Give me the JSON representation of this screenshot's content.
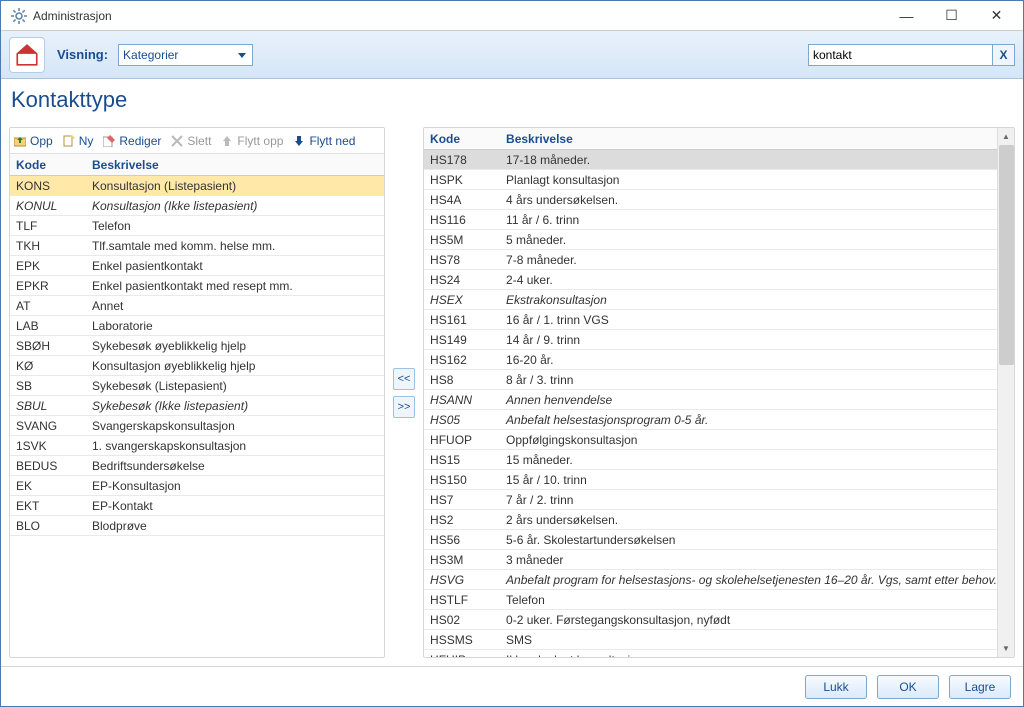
{
  "window": {
    "title": "Administrasjon"
  },
  "topbar": {
    "visning_label": "Visning:",
    "dropdown_value": "Kategorier",
    "search_value": "kontakt"
  },
  "page_title": "Kontakttype",
  "toolbar": {
    "opp": "Opp",
    "ny": "Ny",
    "rediger": "Rediger",
    "slett": "Slett",
    "flytt_opp": "Flytt opp",
    "flytt_ned": "Flytt ned"
  },
  "columns": {
    "kode": "Kode",
    "beskrivelse": "Beskrivelse"
  },
  "left_rows": [
    {
      "kode": "KONS",
      "beskrivelse": "Konsultasjon (Listepasient)",
      "selected": true
    },
    {
      "kode": "KONUL",
      "beskrivelse": "Konsultasjon (Ikke listepasient)",
      "italic": true
    },
    {
      "kode": "TLF",
      "beskrivelse": "Telefon"
    },
    {
      "kode": "TKH",
      "beskrivelse": "Tlf.samtale med komm. helse mm."
    },
    {
      "kode": "EPK",
      "beskrivelse": "Enkel pasientkontakt"
    },
    {
      "kode": "EPKR",
      "beskrivelse": "Enkel pasientkontakt med resept mm."
    },
    {
      "kode": "AT",
      "beskrivelse": "Annet"
    },
    {
      "kode": "LAB",
      "beskrivelse": "Laboratorie"
    },
    {
      "kode": "SBØH",
      "beskrivelse": "Sykebesøk øyeblikkelig hjelp"
    },
    {
      "kode": "KØ",
      "beskrivelse": "Konsultasjon øyeblikkelig hjelp"
    },
    {
      "kode": "SB",
      "beskrivelse": "Sykebesøk (Listepasient)"
    },
    {
      "kode": "SBUL",
      "beskrivelse": "Sykebesøk (Ikke listepasient)",
      "italic": true
    },
    {
      "kode": "SVANG",
      "beskrivelse": "Svangerskapskonsultasjon"
    },
    {
      "kode": "1SVK",
      "beskrivelse": "1. svangerskapskonsultasjon"
    },
    {
      "kode": "BEDUS",
      "beskrivelse": "Bedriftsundersøkelse"
    },
    {
      "kode": "EK",
      "beskrivelse": "EP-Konsultasjon"
    },
    {
      "kode": "EKT",
      "beskrivelse": "EP-Kontakt"
    },
    {
      "kode": "BLO",
      "beskrivelse": "Blodprøve"
    }
  ],
  "right_rows": [
    {
      "kode": "HS178",
      "beskrivelse": "17-18 måneder.",
      "selected": true
    },
    {
      "kode": "HSPK",
      "beskrivelse": "Planlagt konsultasjon"
    },
    {
      "kode": "HS4A",
      "beskrivelse": "4 års undersøkelsen."
    },
    {
      "kode": "HS116",
      "beskrivelse": "11 år / 6. trinn"
    },
    {
      "kode": "HS5M",
      "beskrivelse": "5 måneder."
    },
    {
      "kode": "HS78",
      "beskrivelse": "7-8 måneder."
    },
    {
      "kode": "HS24",
      "beskrivelse": "2-4 uker."
    },
    {
      "kode": "HSEX",
      "beskrivelse": "Ekstrakonsultasjon",
      "italic": true
    },
    {
      "kode": "HS161",
      "beskrivelse": "16 år / 1. trinn VGS"
    },
    {
      "kode": "HS149",
      "beskrivelse": "14 år / 9. trinn"
    },
    {
      "kode": "HS162",
      "beskrivelse": "16-20 år."
    },
    {
      "kode": "HS8",
      "beskrivelse": "8 år / 3. trinn"
    },
    {
      "kode": "HSANN",
      "beskrivelse": "Annen henvendelse",
      "italic": true
    },
    {
      "kode": "HS05",
      "beskrivelse": "Anbefalt helsestasjonsprogram 0-5 år.",
      "italic": true
    },
    {
      "kode": "HFUOP",
      "beskrivelse": "Oppfølgingskonsultasjon"
    },
    {
      "kode": "HS15",
      "beskrivelse": "15 måneder."
    },
    {
      "kode": "HS150",
      "beskrivelse": "15 år / 10. trinn"
    },
    {
      "kode": "HS7",
      "beskrivelse": "7 år / 2. trinn"
    },
    {
      "kode": "HS2",
      "beskrivelse": "2 års undersøkelsen."
    },
    {
      "kode": "HS56",
      "beskrivelse": "5-6 år. Skolestartundersøkelsen"
    },
    {
      "kode": "HS3M",
      "beskrivelse": "3 måneder"
    },
    {
      "kode": "HSVG",
      "beskrivelse": "Anbefalt program for helsestasjons- og skolehelsetjenesten 16–20 år. Vgs, samt etter behov.",
      "italic": true
    },
    {
      "kode": "HSTLF",
      "beskrivelse": "Telefon"
    },
    {
      "kode": "HS02",
      "beskrivelse": "0-2 uker. Førstegangskonsultasjon, nyfødt"
    },
    {
      "kode": "HSSMS",
      "beskrivelse": "SMS"
    },
    {
      "kode": "HFUIP",
      "beskrivelse": "Ikke planlagt konsultasjon"
    }
  ],
  "footer": {
    "lukk": "Lukk",
    "ok": "OK",
    "lagre": "Lagre"
  }
}
